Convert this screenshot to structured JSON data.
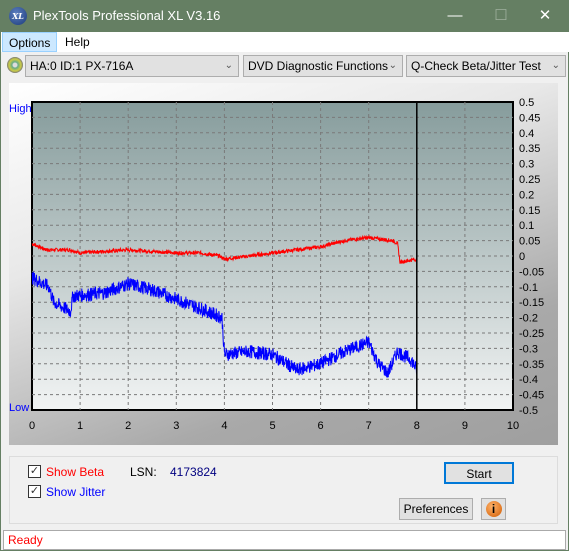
{
  "window": {
    "title": "PlexTools Professional XL V3.16",
    "logo_text": "XL",
    "minimize": "—",
    "maximize": "☐",
    "close": "✕"
  },
  "menu": [
    "Options",
    "Help"
  ],
  "toolbar": {
    "drive": "HA:0 ID:1  PX-716A",
    "function": "DVD Diagnostic Functions",
    "test": "Q-Check Beta/Jitter Test"
  },
  "chart_data": {
    "type": "line",
    "xlim": [
      0,
      10
    ],
    "ylim": [
      -0.5,
      0.5
    ],
    "x_ticks": [
      "0",
      "1",
      "2",
      "3",
      "4",
      "5",
      "6",
      "7",
      "8",
      "9",
      "10"
    ],
    "y_ticks": [
      "0.5",
      "0.45",
      "0.4",
      "0.35",
      "0.3",
      "0.25",
      "0.2",
      "0.15",
      "0.1",
      "0.05",
      "0",
      "-0.05",
      "-0.1",
      "-0.15",
      "-0.2",
      "-0.25",
      "-0.3",
      "-0.35",
      "-0.4",
      "-0.45",
      "-0.5"
    ],
    "left_labels": {
      "high": "High",
      "low": "Low"
    },
    "grid": true,
    "end_marker_x": 8,
    "series": [
      {
        "name": "Beta",
        "color": "#ff0000",
        "points": [
          [
            0,
            0.04
          ],
          [
            0.3,
            0.02
          ],
          [
            0.8,
            0.02
          ],
          [
            1,
            0.01
          ],
          [
            2,
            0.02
          ],
          [
            3,
            0.01
          ],
          [
            3.5,
            0.01
          ],
          [
            3.9,
            0
          ],
          [
            4,
            -0.01
          ],
          [
            4.5,
            0
          ],
          [
            5,
            0.01
          ],
          [
            5.5,
            0.02
          ],
          [
            6,
            0.03
          ],
          [
            6.5,
            0.05
          ],
          [
            7,
            0.06
          ],
          [
            7.5,
            0.05
          ],
          [
            7.6,
            0.04
          ],
          [
            7.65,
            -0.02
          ],
          [
            8,
            -0.01
          ]
        ]
      },
      {
        "name": "Jitter",
        "color": "#0000ff",
        "points": [
          [
            0,
            -0.07
          ],
          [
            0.35,
            -0.1
          ],
          [
            0.45,
            -0.15
          ],
          [
            0.8,
            -0.18
          ],
          [
            0.85,
            -0.13
          ],
          [
            1.5,
            -0.12
          ],
          [
            2,
            -0.09
          ],
          [
            2.5,
            -0.11
          ],
          [
            3,
            -0.14
          ],
          [
            3.5,
            -0.17
          ],
          [
            3.95,
            -0.2
          ],
          [
            4.0,
            -0.32
          ],
          [
            4.5,
            -0.31
          ],
          [
            5,
            -0.32
          ],
          [
            5.5,
            -0.37
          ],
          [
            6,
            -0.35
          ],
          [
            6.5,
            -0.31
          ],
          [
            7,
            -0.28
          ],
          [
            7.2,
            -0.35
          ],
          [
            7.4,
            -0.38
          ],
          [
            7.6,
            -0.31
          ],
          [
            7.9,
            -0.34
          ],
          [
            8,
            -0.37
          ]
        ]
      }
    ]
  },
  "controls": {
    "show_beta": "Show Beta",
    "show_jitter": "Show Jitter",
    "lsn_label": "LSN:",
    "lsn_value": "4173824",
    "start": "Start",
    "preferences": "Preferences",
    "info": "i",
    "beta_checked": true,
    "jitter_checked": true
  },
  "status": "Ready"
}
